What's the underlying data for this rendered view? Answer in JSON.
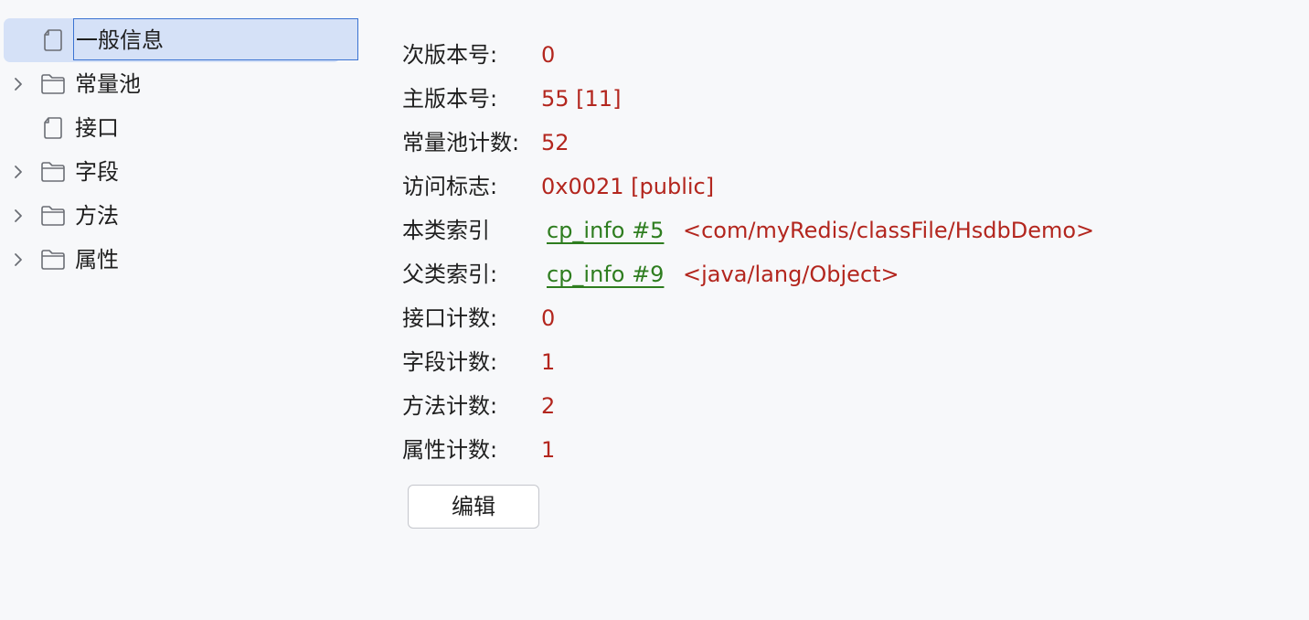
{
  "tree": {
    "items": [
      {
        "label": "一般信息",
        "icon": "file-icon",
        "expandable": false,
        "selected": true
      },
      {
        "label": "常量池",
        "icon": "folder-icon",
        "expandable": true,
        "selected": false
      },
      {
        "label": "接口",
        "icon": "file-icon",
        "expandable": false,
        "selected": false
      },
      {
        "label": "字段",
        "icon": "folder-icon",
        "expandable": true,
        "selected": false
      },
      {
        "label": "方法",
        "icon": "folder-icon",
        "expandable": true,
        "selected": false
      },
      {
        "label": "属性",
        "icon": "folder-icon",
        "expandable": true,
        "selected": false
      }
    ]
  },
  "details": {
    "minor_version": {
      "label": "次版本号:",
      "value": "0"
    },
    "major_version": {
      "label": "主版本号:",
      "value": "55 [11]"
    },
    "constant_pool_count": {
      "label": "常量池计数:",
      "value": "52"
    },
    "access_flags": {
      "label": "访问标志:",
      "value": "0x0021 [public]"
    },
    "this_class": {
      "label": "本类索引",
      "link": "cp_info #5",
      "ref": "<com/myRedis/classFile/HsdbDemo>"
    },
    "super_class": {
      "label": "父类索引:",
      "link": "cp_info #9",
      "ref": "<java/lang/Object>"
    },
    "interfaces_count": {
      "label": "接口计数:",
      "value": "0"
    },
    "fields_count": {
      "label": "字段计数:",
      "value": "1"
    },
    "methods_count": {
      "label": "方法计数:",
      "value": "2"
    },
    "attributes_count": {
      "label": "属性计数:",
      "value": "1"
    }
  },
  "actions": {
    "edit_label": "编辑"
  },
  "colors": {
    "background": "#f7f8fa",
    "selection": "#d5e1f7",
    "focus_border": "#3b73d2",
    "value_red": "#b3261e",
    "link_green": "#2e7d1f"
  }
}
